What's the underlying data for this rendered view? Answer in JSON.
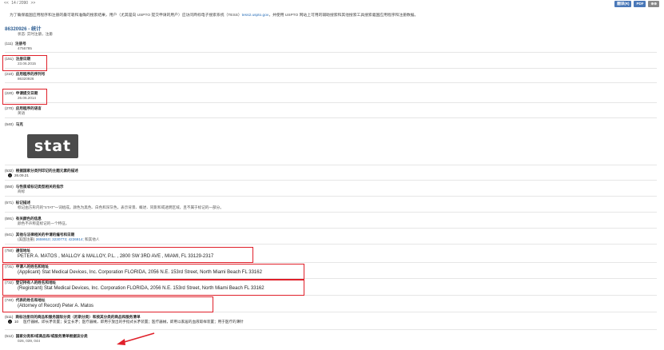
{
  "nav": {
    "prev": "<<",
    "position": "14 / 2090",
    "next": ">>"
  },
  "toolbar": {
    "translate": "翻译(R)",
    "pdf": "PDF",
    "more": "⊕⊕"
  },
  "notice": {
    "before": "为了确保義国应用程序和注册的最可靠和准确的搜索结果，用户（尤其是向 USPTO 提交申请的用户）应访问商标电子搜索系统（TESS）",
    "link": "tess2.uspto.gov",
    "after": "，并使用 USPTO 网站上可用的辅助搜索和其他搜索工具搜索義国应用程序和注册数据。"
  },
  "record": {
    "title": "86320926 - 统计",
    "status": "状态: 实时注册，注册"
  },
  "fields": [
    {
      "code": "(111)",
      "label": "注册号",
      "value": "4756785"
    },
    {
      "code": "(151)",
      "label": "注册日期",
      "value": "23.06.2015"
    },
    {
      "code": "(210)",
      "label": "应用程序的序列号",
      "value": "86320926"
    },
    {
      "code": "(220)",
      "label": "申请提交日期",
      "value": "26.06.2014"
    },
    {
      "code": "(270)",
      "label": "应用程序的语言",
      "value": "英语"
    },
    {
      "code": "(540)",
      "label": "马克",
      "value": ""
    },
    {
      "code": "(532)",
      "label": "根据国家分类列印记的主题元素的描述",
      "value": "26.09.21"
    },
    {
      "code": "(550)",
      "label": "与性质或标记类型相关的指示",
      "value": "商标"
    },
    {
      "code": "(571)",
      "label": "标记描述",
      "value": "标记由方形内的\"STAT\"一词组成。颜色为黑色、白色和深灰色，表示背景、概述、同影和或透明区域，且不属于标记的一部分。"
    },
    {
      "code": "(591)",
      "label": "有关颜色的信息",
      "value": "颜色不声称是标记的一个特征。"
    },
    {
      "code": "(641)",
      "label": "其他与法律相关的申请的编号和日期",
      "value_pre": "(美国注册)",
      "value_links": "2659910; 3230773; 4226914;",
      "value_post": "和其他人"
    },
    {
      "code": "(750)",
      "label": "通信地址",
      "value": "PETER A. MATOS , MALLOY & MALLOY, P.L. , 2800 SW 3RD AVE , MIAMI, FL 33129-2317"
    },
    {
      "code": "(731)",
      "label": "申请人的姓名和地址",
      "value": "(Applicant) Stat Medical Devices, Inc. Corporation FLORIDA, 2056 N.E. 153rd Street, North Miami Beach FL 33162"
    },
    {
      "code": "(732)",
      "label": "登记持有人的姓名和地址",
      "value": "(Registrant) Stat Medical Devices, Inc. Corporation FLORIDA, 2056 N.E. 153rd Street, North Miami Beach FL 33162"
    },
    {
      "code": "(740)",
      "label": "代表的姓名和地址",
      "value": "(Attorney of Record) Peter A. Matos"
    },
    {
      "code": "(511)",
      "label": "商标注册目的商品和服务国际分类（尼斯分类）和按其分类的商品和服务清单",
      "value_num": "10",
      "value": "医疗器械，即长矛装置；安全长矛；医疗器械，即用于放出的手指式长矛装置；医疗器械，即用以家居的血液取样装置；用于医疗的薄针"
    },
    {
      "code": "(512)",
      "label": "国家分类和/或商品和/或服务清单根据该分类",
      "value": "026,  039,  044"
    }
  ],
  "logo_text": "stat",
  "colors": {
    "highlight": "#e0202a",
    "link": "#2a6fb8",
    "title": "#2f5f93"
  }
}
